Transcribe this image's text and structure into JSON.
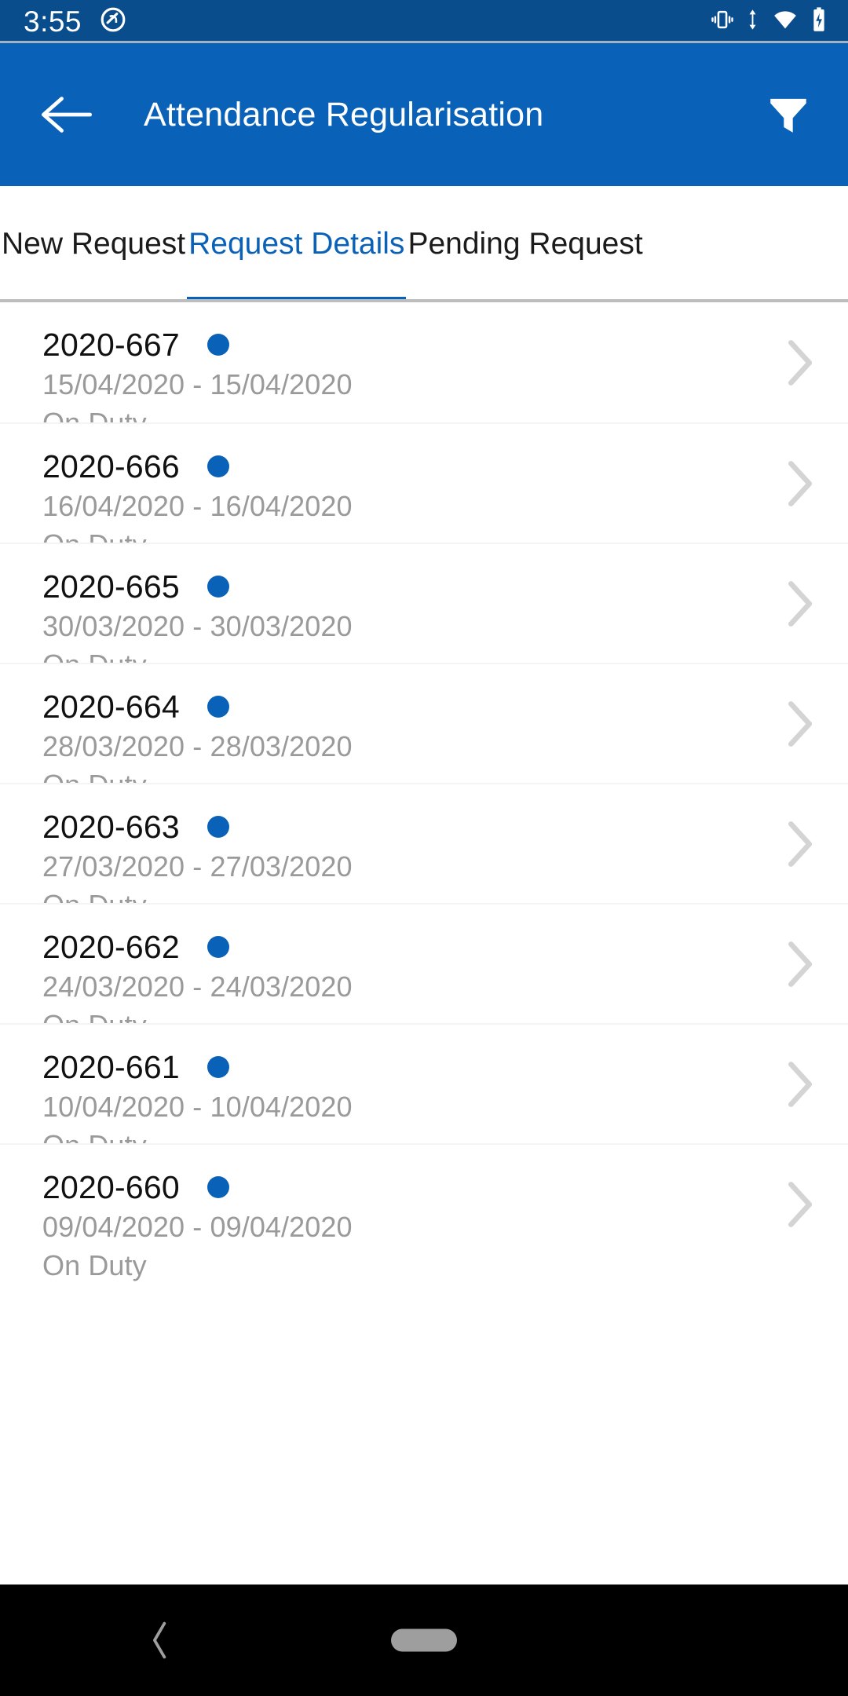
{
  "status_bar": {
    "time": "3:55",
    "icons": {
      "notification_silenced": "do-not-disturb-icon",
      "vibrate": "vibrate-icon",
      "wifi": "wifi-icon",
      "data_transfer": "data-transfer-arrows-icon",
      "battery": "battery-charging-icon"
    },
    "background": "#0a4d8c"
  },
  "app_bar": {
    "back_label": "back-arrow",
    "title": "Attendance Regularisation",
    "filter_label": "filter",
    "background": "#0a62b8",
    "text_color": "#ffffff"
  },
  "tabs": {
    "active_index": 1,
    "active_color": "#0a62b8",
    "inactive_color": "#1b1b1b",
    "items": [
      {
        "label": "New Request"
      },
      {
        "label": "Request Details"
      },
      {
        "label": "Pending Request"
      }
    ]
  },
  "list": {
    "status_dot_color": "#0a62b8",
    "chevron_color": "#d4d4d4",
    "rows": [
      {
        "id": "2020-667",
        "dates": "15/04/2020 - 15/04/2020",
        "type": "On Duty"
      },
      {
        "id": "2020-666",
        "dates": "16/04/2020 - 16/04/2020",
        "type": "On Duty"
      },
      {
        "id": "2020-665",
        "dates": "30/03/2020 - 30/03/2020",
        "type": "On Duty"
      },
      {
        "id": "2020-664",
        "dates": "28/03/2020 - 28/03/2020",
        "type": "On Duty"
      },
      {
        "id": "2020-663",
        "dates": "27/03/2020 - 27/03/2020",
        "type": "On Duty"
      },
      {
        "id": "2020-662",
        "dates": "24/03/2020 - 24/03/2020",
        "type": "On Duty"
      },
      {
        "id": "2020-661",
        "dates": "10/04/2020 - 10/04/2020",
        "type": "On Duty"
      },
      {
        "id": "2020-660",
        "dates": "09/04/2020 - 09/04/2020",
        "type": "On Duty"
      }
    ]
  },
  "nav_bar": {
    "back": "nav-back-icon",
    "home": "nav-home-pill",
    "background": "#000000"
  }
}
